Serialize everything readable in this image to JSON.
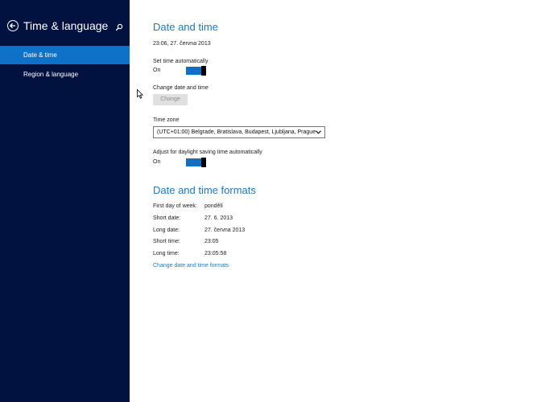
{
  "sidebar": {
    "title": "Time & language",
    "items": [
      {
        "label": "Date & time",
        "active": true
      },
      {
        "label": "Region & language",
        "active": false
      }
    ]
  },
  "icons": {
    "back": "back-arrow-icon",
    "search": "search-icon"
  },
  "colors": {
    "sidebar_bg": "#011240",
    "accent": "#0f70c7",
    "heading": "#1b78c4"
  },
  "date_time": {
    "heading": "Date and time",
    "current": "23:06, 27. června 2013",
    "set_auto_label": "Set time automatically",
    "set_auto_state": "On",
    "change_label": "Change date and time",
    "change_button": "Change",
    "timezone_label": "Time zone",
    "timezone_value": "(UTC+01:00) Belgrade, Bratislava, Budapest, Ljubljana, Prague",
    "dst_label": "Adjust for daylight saving time automatically",
    "dst_state": "On"
  },
  "formats": {
    "heading": "Date and time formats",
    "rows": [
      {
        "label": "First day of week:",
        "value": "pondělí"
      },
      {
        "label": "Short date:",
        "value": "27. 6. 2013"
      },
      {
        "label": "Long date:",
        "value": "27. června 2013"
      },
      {
        "label": "Short time:",
        "value": "23:05"
      },
      {
        "label": "Long time:",
        "value": "23:05:58"
      }
    ],
    "link": "Change date and time formats"
  }
}
